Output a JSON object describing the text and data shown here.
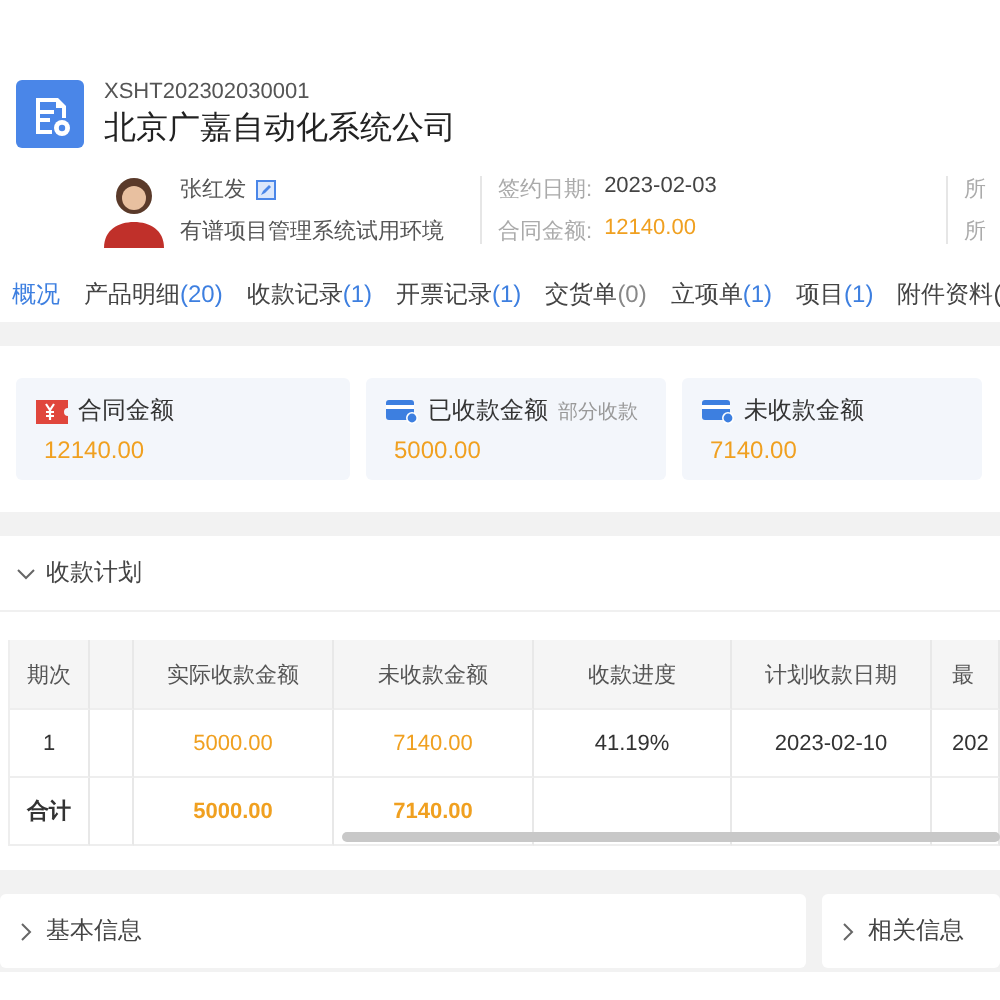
{
  "contract": {
    "code": "XSHT202302030001",
    "title": "北京广嘉自动化系统公司"
  },
  "owner": {
    "name": "张红发",
    "org": "有谱项目管理系统试用环境"
  },
  "fields": [
    {
      "label": "签约日期:",
      "value": "2023-02-03",
      "kind": "plain"
    },
    {
      "label": "合同金额:",
      "value": "12140.00",
      "kind": "amount"
    }
  ],
  "cut_labels": [
    "所",
    "所"
  ],
  "tabs": [
    {
      "label": "概况",
      "selected": true
    },
    {
      "label": "产品明细",
      "count": "(20)",
      "count_active": true,
      "selected": false
    },
    {
      "label": "收款记录",
      "count": "(1)",
      "count_active": true,
      "selected": false
    },
    {
      "label": "开票记录",
      "count": "(1)",
      "count_active": true,
      "selected": false
    },
    {
      "label": "交货单",
      "count": "(0)",
      "count_active": false,
      "selected": false
    },
    {
      "label": "立项单",
      "count": "(1)",
      "count_active": true,
      "selected": false
    },
    {
      "label": "项目",
      "count": "(1)",
      "count_active": true,
      "selected": false
    },
    {
      "label": "附件资料(",
      "selected": false
    }
  ],
  "summary_cards": [
    {
      "kind": "yuan",
      "label": "合同金额",
      "value": "12140.00"
    },
    {
      "kind": "card-check",
      "label": "已收款金额",
      "tag": "部分收款",
      "value": "5000.00"
    },
    {
      "kind": "card-info",
      "label": "未收款金额",
      "value": "7140.00"
    }
  ],
  "plan": {
    "title": "收款计划",
    "expanded": true,
    "columns": [
      {
        "label": "期次",
        "kind": "index"
      },
      {
        "label": "实际收款金额",
        "kind": "amount"
      },
      {
        "label": "未收款金额",
        "kind": "amount"
      },
      {
        "label": "收款进度",
        "kind": "plain"
      },
      {
        "label": "计划收款日期",
        "kind": "plain"
      },
      {
        "label": "最",
        "kind": "cut"
      }
    ],
    "rows": [
      {
        "kind": "data",
        "cells": [
          "1",
          "5000.00",
          "7140.00",
          "41.19%",
          "2023-02-10",
          "202"
        ]
      },
      {
        "kind": "total",
        "cells": [
          "合计",
          "5000.00",
          "7140.00"
        ]
      }
    ]
  },
  "panels": [
    {
      "title": "基本信息",
      "expanded": false
    },
    {
      "title": "相关信息",
      "expanded": false
    }
  ]
}
